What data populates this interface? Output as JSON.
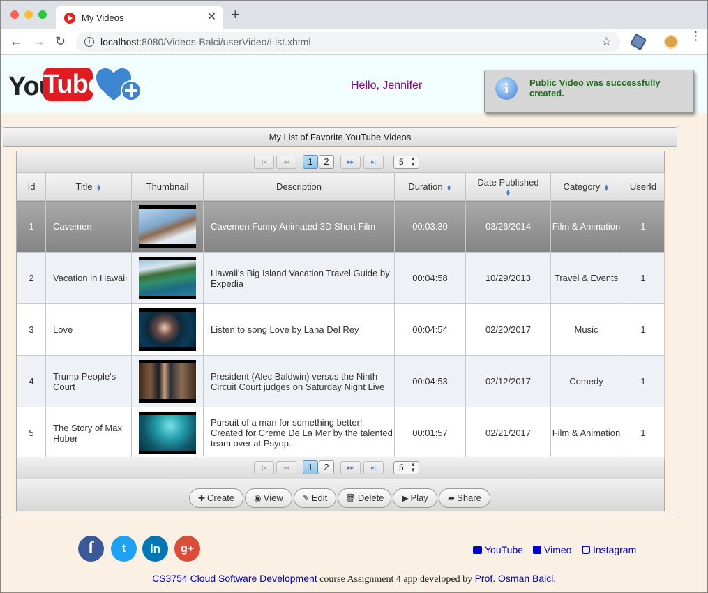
{
  "browser": {
    "tab_title": "My Videos",
    "url_host": "localhost",
    "url_rest": ":8080/Videos-Balci/userVideo/List.xhtml"
  },
  "header": {
    "logo_you": "You",
    "logo_tube": "Tube",
    "greeting": "Hello, Jennifer",
    "message": "Public Video was successfully created."
  },
  "panel": {
    "title": "My List of Favorite YouTube Videos"
  },
  "paginator": {
    "first": "|◂",
    "prev": "◂◂",
    "next": "▸▸",
    "last": "▸|",
    "pages": [
      "1",
      "2"
    ],
    "rows_per_page": "5"
  },
  "table": {
    "columns": [
      "Id",
      "Title",
      "Thumbnail",
      "Description",
      "Duration",
      "Date Published",
      "Category",
      "UserId"
    ],
    "rows": [
      {
        "id": "1",
        "title": "Cavemen",
        "description": "Cavemen Funny Animated 3D Short Film",
        "duration": "00:03:30",
        "date": "03/26/2014",
        "category": "Film & Animation",
        "user_id": "1"
      },
      {
        "id": "2",
        "title": "Vacation in Hawaii",
        "description": "Hawaii's Big Island Vacation Travel Guide by Expedia",
        "duration": "00:04:58",
        "date": "10/29/2013",
        "category": "Travel & Events",
        "user_id": "1"
      },
      {
        "id": "3",
        "title": "Love",
        "description": "Listen to song Love by Lana Del Rey",
        "duration": "00:04:54",
        "date": "02/20/2017",
        "category": "Music",
        "user_id": "1"
      },
      {
        "id": "4",
        "title": "Trump People's Court",
        "description": "President (Alec Baldwin) versus the Ninth Circuit Court judges on Saturday Night Live",
        "duration": "00:04:53",
        "date": "02/12/2017",
        "category": "Comedy",
        "user_id": "1"
      },
      {
        "id": "5",
        "title": "The Story of Max Huber",
        "description": "Pursuit of a man for something better! Created for Creme De La Mer by the talented team over at Psyop.",
        "duration": "00:01:57",
        "date": "02/21/2017",
        "category": "Film & Animation",
        "user_id": "1"
      }
    ]
  },
  "actions": {
    "create": "Create",
    "view": "View",
    "edit": "Edit",
    "delete": "Delete",
    "play": "Play",
    "share": "Share"
  },
  "footer": {
    "social": [
      "f",
      "t",
      "in",
      "g+"
    ],
    "links": [
      "YouTube",
      "Vimeo",
      "Instagram"
    ],
    "course_link": "CS3754 Cloud Software Development",
    "credit_text": " course Assignment 4 app developed by ",
    "author_link": "Prof. Osman Balci",
    "period": "."
  },
  "colors": {
    "youtube_red": "#e11b22",
    "greeting": "#8b008b",
    "message_green": "#1e6e1e",
    "link": "#0000cc",
    "facebook": "#3b5998",
    "twitter": "#1da1f2",
    "linkedin": "#0077b5",
    "googleplus": "#dd4b39"
  }
}
